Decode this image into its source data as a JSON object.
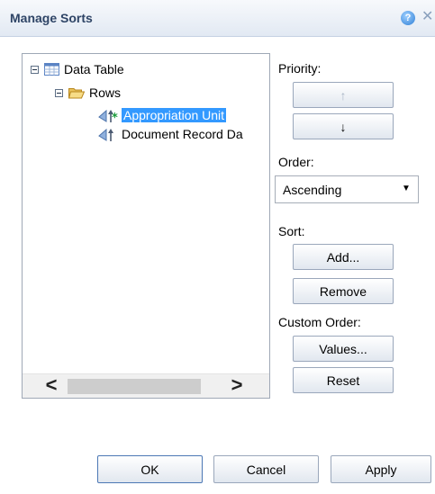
{
  "dialog": {
    "title": "Manage Sorts"
  },
  "tree": {
    "root": {
      "label": "Data Table"
    },
    "group": {
      "label": "Rows"
    },
    "items": [
      {
        "label": "Appropriation Unit"
      },
      {
        "label": "Document Record Da"
      }
    ]
  },
  "priority": {
    "label": "Priority:",
    "up_glyph": "↑",
    "down_glyph": "↓"
  },
  "order": {
    "label": "Order:",
    "selected": "Ascending"
  },
  "sort": {
    "label": "Sort:",
    "add": "Add...",
    "remove": "Remove"
  },
  "custom_order": {
    "label": "Custom Order:",
    "values": "Values...",
    "reset": "Reset"
  },
  "footer": {
    "ok": "OK",
    "cancel": "Cancel",
    "apply": "Apply"
  },
  "scrollbar": {
    "left": "<",
    "right": ">"
  },
  "colors": {
    "selection": "#3399ff",
    "title_text": "#2e4466"
  },
  "icons": {
    "table": "table-icon",
    "folder": "folder-icon",
    "sort_asc_active": "sort-ascending-active-icon",
    "sort": "sort-icon",
    "help": "help-icon",
    "close": "close-icon"
  }
}
